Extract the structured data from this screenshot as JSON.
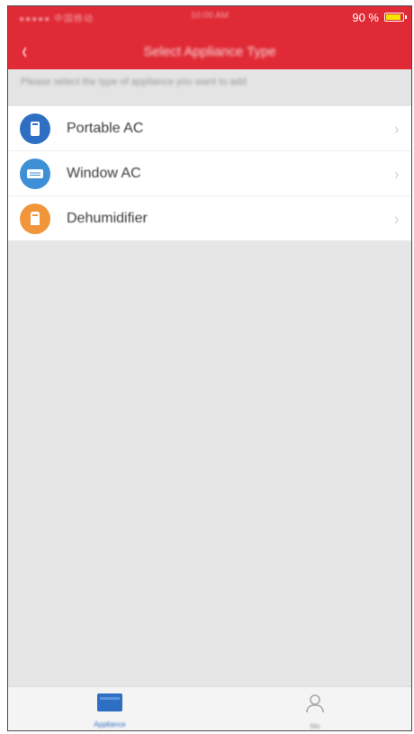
{
  "status_bar": {
    "carrier": "●●●●● 中国移动",
    "time": "10:00 AM",
    "battery_percent": "90 %",
    "battery_level": 0.9
  },
  "nav": {
    "back_icon": "chevron-left-icon",
    "title": "Select Appliance Type"
  },
  "hint": "Please select the type of appliance you want to add",
  "appliances": [
    {
      "label": "Portable AC",
      "icon": "portable-ac-icon",
      "color": "#2f6fc3"
    },
    {
      "label": "Window AC",
      "icon": "window-ac-icon",
      "color": "#3d8fd6"
    },
    {
      "label": "Dehumidifier",
      "icon": "dehumidifier-icon",
      "color": "#f0953a"
    }
  ],
  "tabs": [
    {
      "label": "Appliance",
      "icon": "appliance-icon",
      "active": true
    },
    {
      "label": "Me",
      "icon": "user-icon",
      "active": false
    }
  ],
  "colors": {
    "header": "#e02a35",
    "background": "#e6e6e6",
    "active_tab": "#2f6fc3"
  }
}
